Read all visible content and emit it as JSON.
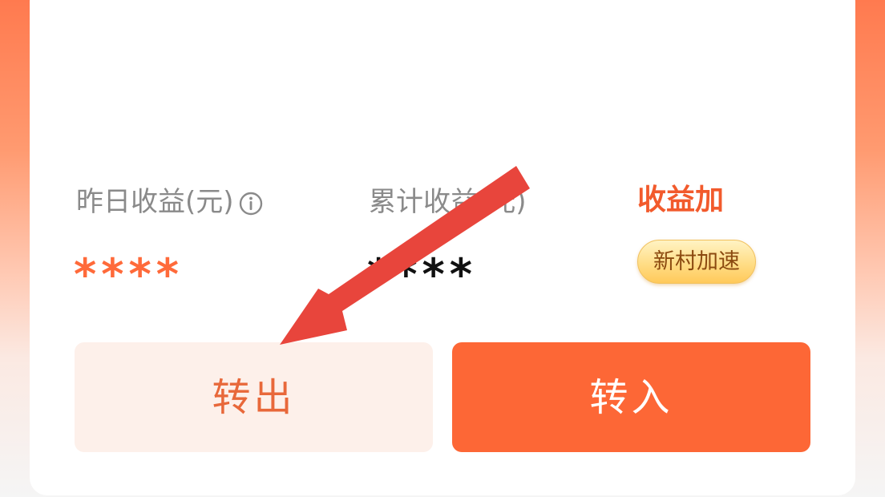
{
  "balance": {
    "masked_value": "****"
  },
  "stats": {
    "yesterday": {
      "label": "昨日收益(元)",
      "value": "****"
    },
    "total": {
      "label": "累计收益(元)",
      "value": "****"
    }
  },
  "boost": {
    "title": "收益加",
    "badge_label": "新村加速"
  },
  "actions": {
    "transfer_out_label": "转出",
    "transfer_in_label": "转入"
  },
  "colors": {
    "accent": "#fd6736",
    "accent_text": "#f25a2c",
    "transfer_out_bg": "#fdf0ea",
    "arrow": "#e8453c"
  },
  "icons": {
    "info": "info-circle-icon",
    "annotation": "red-arrow-annotation"
  }
}
